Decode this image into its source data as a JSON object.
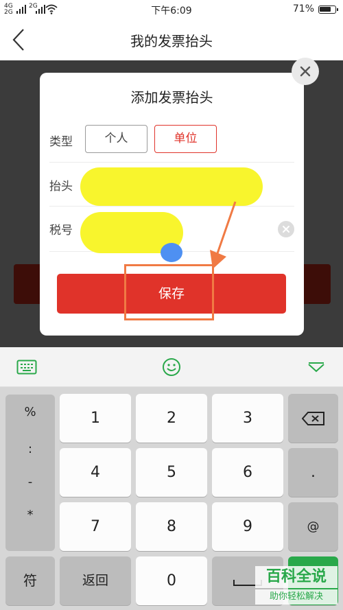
{
  "status_bar": {
    "signal_left": "4G",
    "signal_left_b": "2G",
    "signal_right": "2G",
    "time": "下午6:09",
    "battery": "71%"
  },
  "nav": {
    "back_icon": "chevron-left-icon",
    "title": "我的发票抬头"
  },
  "dialog": {
    "title": "添加发票抬头",
    "type_label": "类型",
    "type_options": [
      "个人",
      "单位"
    ],
    "selected_type": "单位",
    "header_label": "抬头",
    "tax_label": "税号",
    "save_label": "保存",
    "close_icon": "close-icon",
    "clear_icon": "clear-icon"
  },
  "keyboard": {
    "toolbar_icons": [
      "keyboard-icon",
      "emoji-icon",
      "collapse-icon"
    ],
    "symbols": [
      "%",
      ":",
      "-",
      "*"
    ],
    "digits": [
      "1",
      "2",
      "3",
      "4",
      "5",
      "6",
      "7",
      "8",
      "9",
      "0"
    ],
    "right_keys": [
      "backspace-icon",
      ".",
      "@"
    ],
    "fu_label": "符",
    "back_label": "返回"
  },
  "watermark": {
    "title": "百科全说",
    "subtitle": "助你轻松解决"
  },
  "colors": {
    "accent_red": "#e0332a",
    "highlight_yellow": "#f8f52d",
    "annotation_orange": "#f07a44",
    "keyboard_green": "#29a84a"
  }
}
